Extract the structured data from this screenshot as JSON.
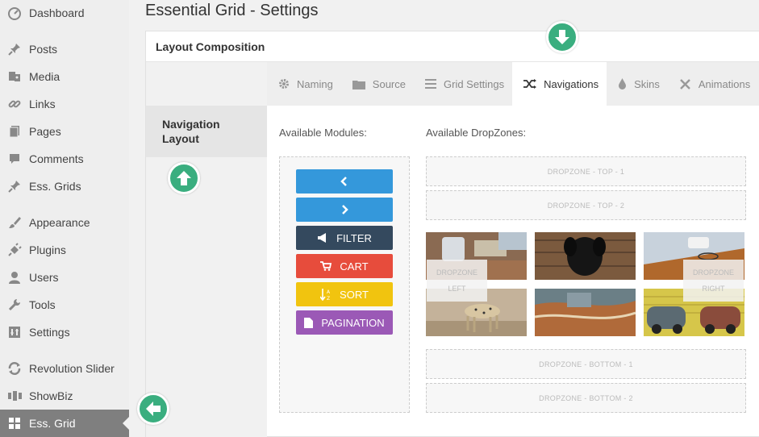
{
  "sidebar": {
    "items": [
      {
        "label": "Dashboard",
        "icon": "dashboard-icon"
      },
      {
        "label": "Posts",
        "icon": "pin-icon"
      },
      {
        "label": "Media",
        "icon": "media-icon"
      },
      {
        "label": "Links",
        "icon": "link-icon"
      },
      {
        "label": "Pages",
        "icon": "pages-icon"
      },
      {
        "label": "Comments",
        "icon": "comment-icon"
      },
      {
        "label": "Ess. Grids",
        "icon": "pin-icon"
      },
      {
        "label": "Appearance",
        "icon": "brush-icon"
      },
      {
        "label": "Plugins",
        "icon": "plugin-icon"
      },
      {
        "label": "Users",
        "icon": "user-icon"
      },
      {
        "label": "Tools",
        "icon": "wrench-icon"
      },
      {
        "label": "Settings",
        "icon": "settings-icon"
      },
      {
        "label": "Revolution Slider",
        "icon": "refresh-icon"
      },
      {
        "label": "ShowBiz",
        "icon": "showbiz-icon"
      },
      {
        "label": "Ess. Grid",
        "icon": "grid-icon",
        "active": true
      }
    ]
  },
  "page": {
    "title": "Essential Grid - Settings"
  },
  "panel": {
    "header": "Layout Composition",
    "section_label": "Navigation Layout"
  },
  "tabs": [
    {
      "label": "Naming",
      "icon": "gear-icon"
    },
    {
      "label": "Source",
      "icon": "folder-icon"
    },
    {
      "label": "Grid Settings",
      "icon": "list-icon"
    },
    {
      "label": "Navigations",
      "icon": "shuffle-icon",
      "active": true
    },
    {
      "label": "Skins",
      "icon": "drop-icon"
    },
    {
      "label": "Animations",
      "icon": "tools-icon"
    }
  ],
  "content": {
    "modules_label": "Available Modules:",
    "dropzones_label": "Available DropZones:"
  },
  "modules": [
    {
      "label": "",
      "icon": "chevron-left-icon",
      "color": "#3498db"
    },
    {
      "label": "",
      "icon": "chevron-right-icon",
      "color": "#3498db"
    },
    {
      "label": "FILTER",
      "icon": "bullhorn-icon",
      "color": "#34495e"
    },
    {
      "label": "CART",
      "icon": "cart-icon",
      "color": "#e74c3c"
    },
    {
      "label": "SORT",
      "icon": "sort-alpha-icon",
      "color": "#f1c40f"
    },
    {
      "label": "PAGINATION",
      "icon": "file-icon",
      "color": "#9b59b6"
    }
  ],
  "dropzones": {
    "top1": "DROPZONE - TOP - 1",
    "top2": "DROPZONE - TOP - 2",
    "left_line1": "DROPZONE",
    "left_line2": "LEFT",
    "right_line1": "DROPZONE",
    "right_line2": "RIGHT",
    "bottom1": "DROPZONE - BOTTOM - 1",
    "bottom2": "DROPZONE - BOTTOM - 2"
  },
  "colors": {
    "accent_green": "#3aae7f",
    "sidebar_active": "#7f7f7f"
  }
}
